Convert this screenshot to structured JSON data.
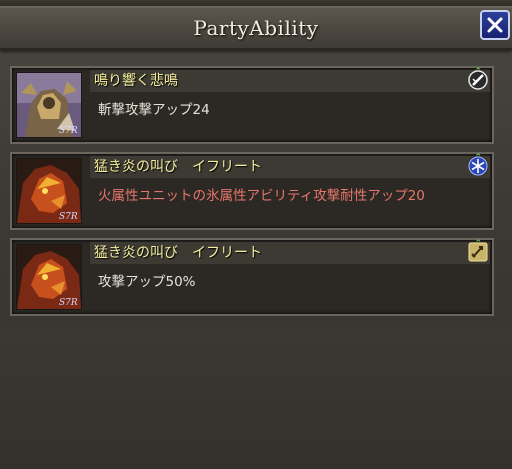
{
  "header": {
    "title": "PartyAbility"
  },
  "close_icon": "close-x-icon",
  "abilities": [
    {
      "name": "鳴り響く悲鳴",
      "description": "斬撃攻撃アップ24",
      "desc_color": "#e6e2d8",
      "icon": "slash-attack-icon",
      "portrait": "armored-knight-portrait"
    },
    {
      "name": "猛き炎の叫び　イフリート",
      "description": "火属性ユニットの氷属性アビリティ攻撃耐性アップ20",
      "desc_color": "#e5766a",
      "icon": "ice-snowflake-icon",
      "portrait": "ifrit-portrait"
    },
    {
      "name": "猛き炎の叫び　イフリート",
      "description": "攻撃アップ50%",
      "desc_color": "#e6e2d8",
      "icon": "attack-up-icon",
      "portrait": "ifrit-portrait"
    }
  ],
  "colors": {
    "name_text": "#f5ee9c",
    "close_button": "#1f2d85"
  }
}
